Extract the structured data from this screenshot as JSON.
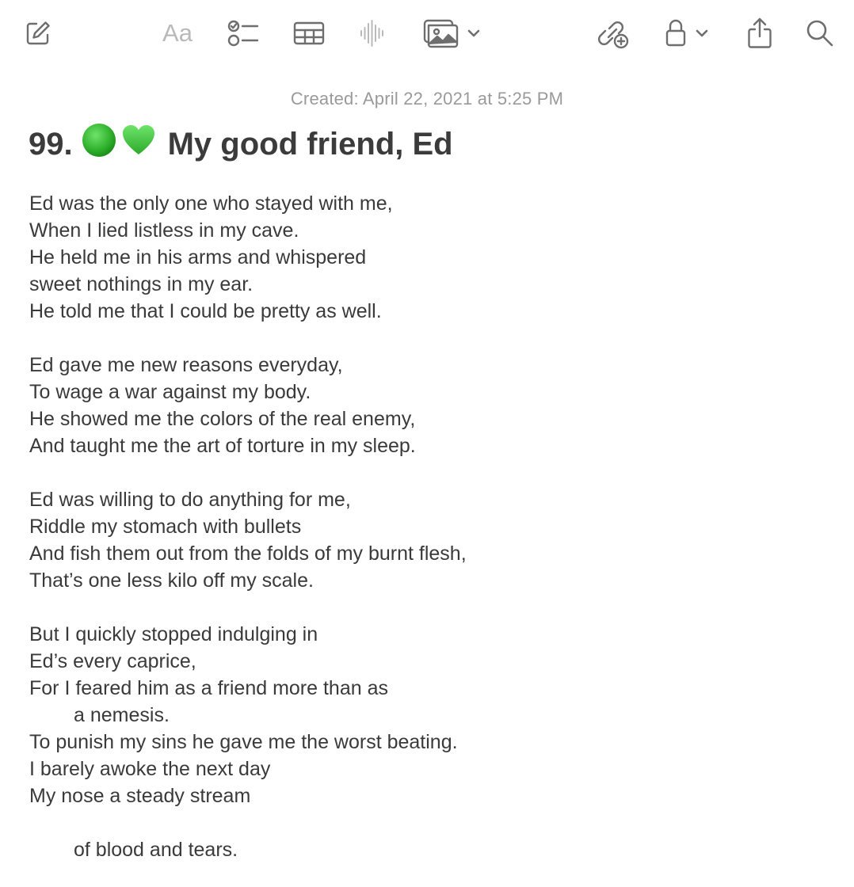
{
  "toolbar": {
    "compose": {
      "icon": "compose-icon"
    },
    "format": {
      "label": "Aa",
      "icon": "text-format-icon"
    },
    "checklist": {
      "icon": "checklist-icon"
    },
    "table": {
      "icon": "table-icon"
    },
    "audio": {
      "icon": "audio-waveform-icon"
    },
    "media": {
      "icon": "photo-media-icon",
      "dropdown_icon": "chevron-down-icon"
    },
    "collaborate": {
      "icon": "collaborate-link-icon"
    },
    "lock": {
      "icon": "lock-icon",
      "dropdown_icon": "chevron-down-icon"
    },
    "share": {
      "icon": "share-icon"
    },
    "search": {
      "icon": "search-icon"
    }
  },
  "note": {
    "created": "Created: April 22, 2021 at 5:25 PM",
    "title_number": "99.",
    "title_emoji_1": "🟢",
    "title_emoji_2": "💚",
    "title_text": "My good friend, Ed",
    "lines": [
      {
        "text": "Ed was the only one who stayed with me,"
      },
      {
        "text": "When I lied listless in my cave."
      },
      {
        "text": "He held me in his arms and whispered"
      },
      {
        "text": "sweet nothings in my ear."
      },
      {
        "text": "He told me that I could be pretty as well."
      },
      {
        "text": ""
      },
      {
        "text": "Ed gave me new reasons everyday,"
      },
      {
        "text": "To wage a war against my body."
      },
      {
        "text": "He showed me the colors of the real enemy,"
      },
      {
        "text": "And taught me the art of torture in my sleep."
      },
      {
        "text": ""
      },
      {
        "text": "Ed was willing to do anything for me,"
      },
      {
        "text": "Riddle my stomach with bullets"
      },
      {
        "text": "And fish them out from the folds of my burnt flesh,"
      },
      {
        "text": "That’s one less kilo off my scale."
      },
      {
        "text": ""
      },
      {
        "text": "But I quickly stopped indulging in"
      },
      {
        "text": "Ed’s every caprice,"
      },
      {
        "text": "For I feared him as a friend more than as"
      },
      {
        "text": "a nemesis.",
        "indent": true
      },
      {
        "text": "To punish my sins he gave me the worst beating."
      },
      {
        "text": "I barely awoke the next day"
      },
      {
        "text": "My nose a steady stream"
      },
      {
        "text": ""
      },
      {
        "text": "of blood and tears.",
        "indent": true
      }
    ]
  },
  "colors": {
    "icon": "#6e6e6e",
    "icon_disabled": "#b9b9b9",
    "text": "#3a3a3a",
    "meta_text": "#9a9a9a",
    "emoji_green": "#3fbf3f"
  }
}
